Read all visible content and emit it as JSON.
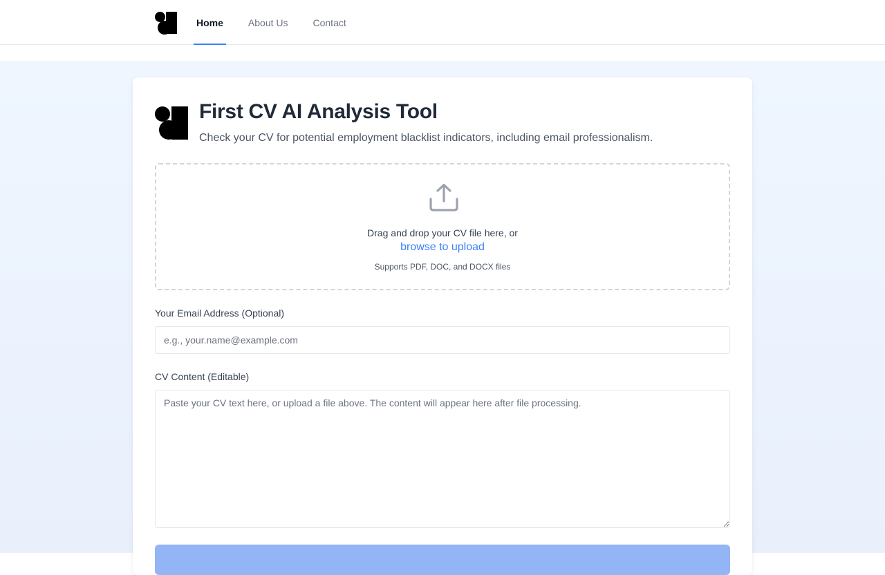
{
  "nav": {
    "items": [
      {
        "label": "Home",
        "active": true
      },
      {
        "label": "About Us",
        "active": false
      },
      {
        "label": "Contact",
        "active": false
      }
    ]
  },
  "card": {
    "title": "First CV AI Analysis Tool",
    "subtitle": "Check your CV for potential employment blacklist indicators, including email professionalism."
  },
  "upload": {
    "icon": "upload-icon",
    "drop_text": "Drag and drop your CV file here, or",
    "browse_label": "browse to upload",
    "supported_text": "Supports PDF, DOC, and DOCX files"
  },
  "email": {
    "label": "Your Email Address (Optional)",
    "placeholder": "e.g., your.name@example.com",
    "value": ""
  },
  "cv_content": {
    "label": "CV Content (Editable)",
    "placeholder": "Paste your CV text here, or upload a file above. The content will appear here after file processing.",
    "value": ""
  },
  "colors": {
    "accent": "#3b82f6",
    "background": "#eff6ff",
    "button_disabled": "#93b4f5"
  }
}
